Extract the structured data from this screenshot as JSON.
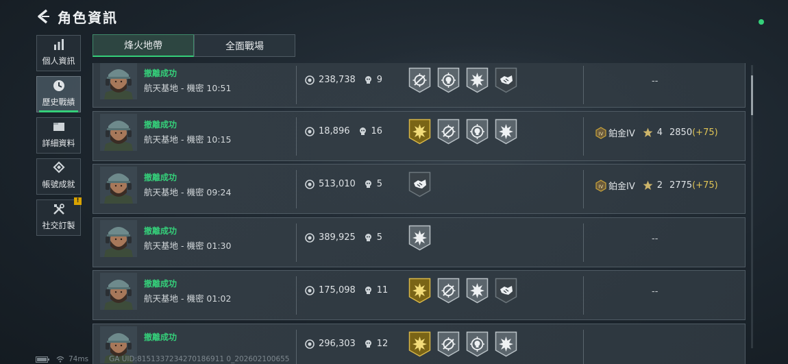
{
  "header": {
    "title": "角色資訊"
  },
  "side_nav": [
    {
      "label": "個人資訊",
      "icon": "bar-chart-icon"
    },
    {
      "label": "歷史戰績",
      "icon": "clock-icon",
      "active": true
    },
    {
      "label": "詳細資料",
      "icon": "folder-icon"
    },
    {
      "label": "帳號成就",
      "icon": "achievement-icon"
    },
    {
      "label": "社交訂製",
      "icon": "tools-icon",
      "badge": "!"
    }
  ],
  "tabs": [
    {
      "label": "烽火地帶",
      "active": true
    },
    {
      "label": "全面戰場",
      "active": false
    }
  ],
  "matches": [
    {
      "status": "撤離成功",
      "map": "航天基地 - 機密 10:51",
      "money": "238,738",
      "kills": "9",
      "badges": [
        "silver-reticle",
        "silver-crosshair-skull",
        "silver-burst",
        "dark-handshake"
      ],
      "result": "--"
    },
    {
      "status": "撤離成功",
      "map": "航天基地 - 機密 10:15",
      "money": "18,896",
      "kills": "16",
      "badges": [
        "gold-burst",
        "silver-reticle",
        "silver-crosshair-skull",
        "silver-burst"
      ],
      "rank_name": "鉑金IV",
      "stars": "4",
      "score": "2850",
      "delta": "(+75)"
    },
    {
      "status": "撤離成功",
      "map": "航天基地 - 機密 09:24",
      "money": "513,010",
      "kills": "5",
      "badges": [
        "dark-handshake"
      ],
      "rank_name": "鉑金IV",
      "stars": "2",
      "score": "2775",
      "delta": "(+75)"
    },
    {
      "status": "撤離成功",
      "map": "航天基地 - 機密 01:30",
      "money": "389,925",
      "kills": "5",
      "badges": [
        "silver-burst"
      ],
      "result": "--"
    },
    {
      "status": "撤離成功",
      "map": "航天基地 - 機密 01:02",
      "money": "175,098",
      "kills": "11",
      "badges": [
        "gold-burst",
        "silver-reticle",
        "silver-burst",
        "dark-handshake"
      ],
      "result": "--"
    },
    {
      "status": "撤離成功",
      "map": "",
      "money": "296,303",
      "kills": "12",
      "badges": [
        "gold-burst",
        "silver-reticle",
        "silver-crosshair-skull",
        "silver-burst"
      ],
      "result": ""
    }
  ],
  "footer": {
    "ping": "74ms",
    "uid": "GA UID:8151337234270186911 0_202602100655"
  },
  "colors": {
    "accent": "#35d07a",
    "gold": "#c9a43a",
    "delta": "#e0c455"
  }
}
